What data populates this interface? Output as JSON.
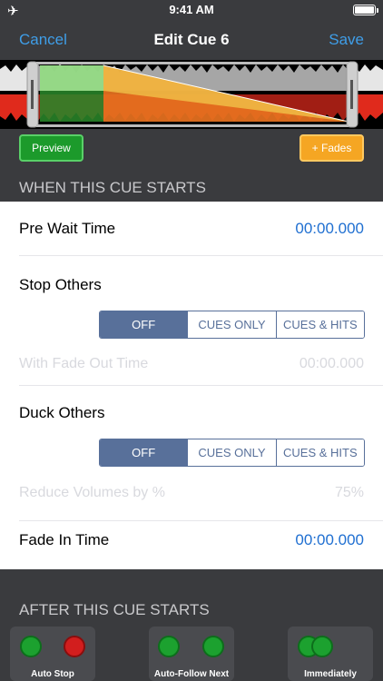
{
  "status": {
    "time": "9:41 AM"
  },
  "nav": {
    "cancel_label": "Cancel",
    "title": "Edit Cue 6",
    "save_label": "Save"
  },
  "buttons": {
    "preview_label": "Preview",
    "fades_label": "+ Fades"
  },
  "sections": {
    "when_starts": "WHEN THIS CUE STARTS",
    "after_starts": "AFTER THIS CUE STARTS"
  },
  "pre_wait": {
    "label": "Pre Wait Time",
    "value": "00:00.000"
  },
  "stop_others": {
    "label": "Stop Others",
    "options": [
      "OFF",
      "CUES ONLY",
      "CUES & HITS"
    ],
    "selected": "OFF",
    "fade_label": "With Fade Out Time",
    "fade_value": "00:00.000"
  },
  "duck_others": {
    "label": "Duck Others",
    "options": [
      "OFF",
      "CUES ONLY",
      "CUES & HITS"
    ],
    "selected": "OFF",
    "reduce_label": "Reduce Volumes by %",
    "reduce_value": "75%"
  },
  "fade_in": {
    "label": "Fade In Time",
    "value": "00:00.000"
  },
  "after": [
    {
      "label": "Auto Stop"
    },
    {
      "label": "Auto-Follow Next"
    },
    {
      "label": "Immediately"
    }
  ],
  "colors": {
    "accent": "#3f9ee8",
    "value_blue": "#1f6fd1",
    "segment": "#58709a",
    "preview": "#1c9a2b",
    "fades": "#f5a623"
  },
  "icons": {
    "status_left": "airplane-icon",
    "battery": "battery-icon"
  }
}
